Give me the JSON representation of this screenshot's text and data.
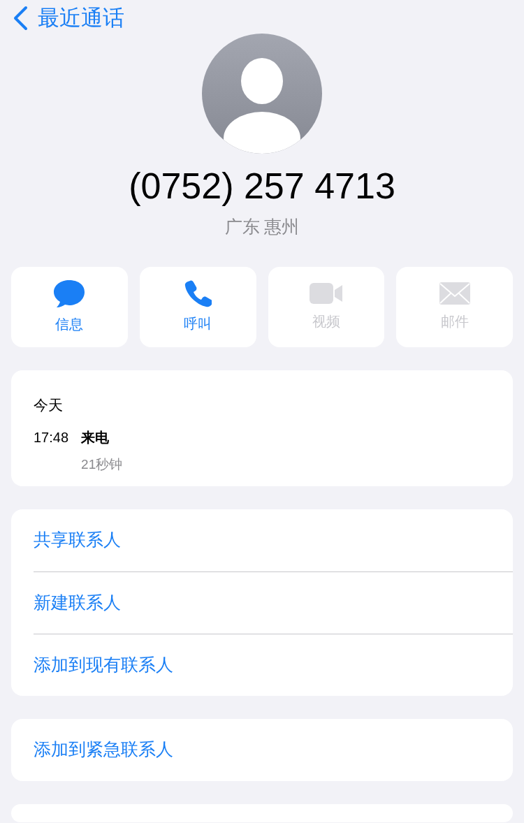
{
  "nav": {
    "back_label": "最近通话"
  },
  "contact": {
    "number": "(0752) 257 4713",
    "location": "广东 惠州"
  },
  "actions": [
    {
      "kind": "message",
      "label": "信息",
      "disabled": false
    },
    {
      "kind": "call",
      "label": "呼叫",
      "disabled": false
    },
    {
      "kind": "video",
      "label": "视频",
      "disabled": true
    },
    {
      "kind": "mail",
      "label": "邮件",
      "disabled": true
    }
  ],
  "recents": {
    "day": "今天",
    "entries": [
      {
        "time": "17:48",
        "type": "来电",
        "duration": "21秒钟"
      }
    ]
  },
  "groups": [
    {
      "items": [
        "共享联系人",
        "新建联系人",
        "添加到现有联系人"
      ]
    },
    {
      "items": [
        "添加到紧急联系人"
      ]
    }
  ],
  "more_below": true
}
